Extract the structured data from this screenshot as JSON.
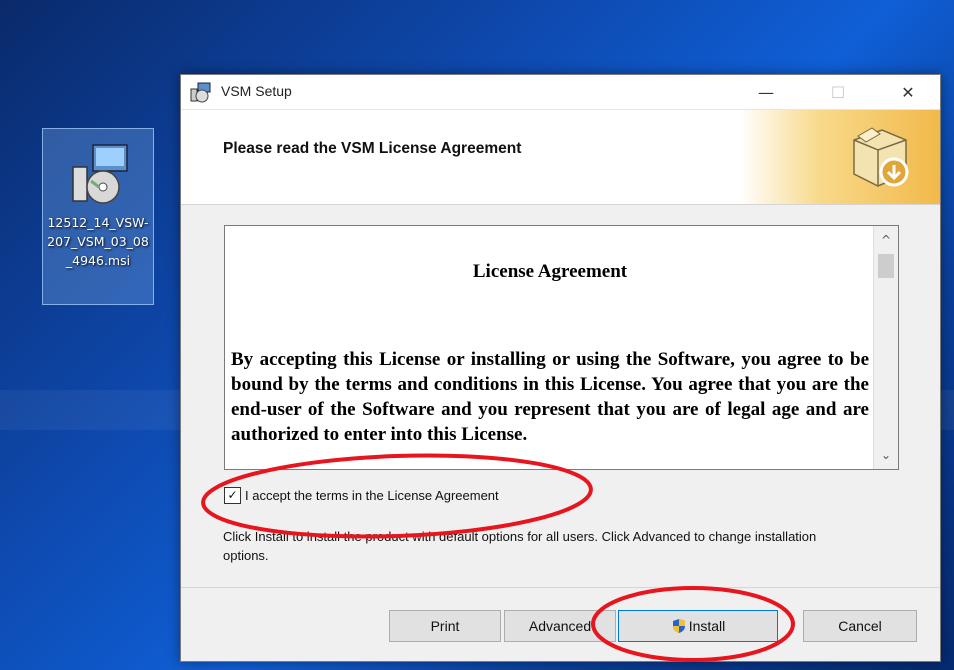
{
  "desktop": {
    "icon_label": "12512_14_VSW-207_VSM_03_08_4946.msi"
  },
  "window": {
    "title": "VSM Setup",
    "min_glyph": "—",
    "max_glyph": "☐",
    "close_glyph": "✕"
  },
  "header": {
    "heading": "Please read the VSM License Agreement"
  },
  "license": {
    "title": "License Agreement",
    "body": "By accepting this License or installing or using the Software, you agree to be bound by the terms and conditions in this License.  You agree that you are the end-user of the Software and you represent that you are of legal age and are authorized to enter into this License."
  },
  "accept": {
    "checked_glyph": "✓",
    "label": "I accept the terms in the License Agreement"
  },
  "help": {
    "text": "Click Install to install the product with default options for all users. Click Advanced to change installation options."
  },
  "buttons": {
    "print": "Print",
    "advanced": "Advanced",
    "install": "Install",
    "cancel": "Cancel"
  },
  "scrollbar": {
    "up_glyph": "^",
    "down_glyph": "⌄"
  },
  "colors": {
    "annotation": "#e8141e",
    "install_focus": "#0078d7"
  }
}
